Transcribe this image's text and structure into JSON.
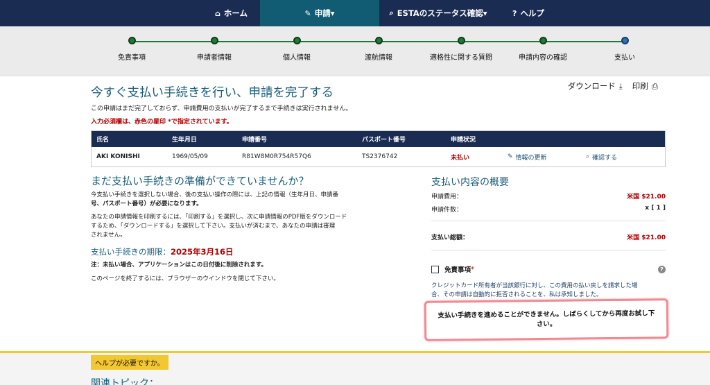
{
  "nav": {
    "home": "ホーム",
    "apply": "申請▾",
    "status": "ESTAのステータス確認▾",
    "help": "ヘルプ"
  },
  "steps": [
    "免責事項",
    "申請者情報",
    "個人情報",
    "渡航情報",
    "適格性に関する質問",
    "申請内容の確認",
    "支払い"
  ],
  "page": {
    "title": "今すぐ支払い手続きを行い、申請を完了する",
    "download": "ダウンロード",
    "print": "印刷",
    "notice": "この申請はまだ完了しておらず、申請費用の支払いが完了するまで手続きは実行されません。",
    "required_note": "入力必須欄は、赤色の星印 *で指定されています。"
  },
  "table": {
    "headers": [
      "氏名",
      "生年月日",
      "申請番号",
      "パスポート番号",
      "申請状況"
    ],
    "row": {
      "name": "AKI KONISHI",
      "dob": "1969/05/09",
      "app_no": "R81W8M0R754R57Q6",
      "passport": "TS2376742",
      "status": "未払い",
      "update": "情報の更新",
      "check": "確認する"
    }
  },
  "left": {
    "heading": "まだ支払い手続きの準備ができていませんか？",
    "p1_line1": "今支払い手続きを選択しない場合、後の支払い操作の際には、上記の情報（生年月日、申請番",
    "p1_line2": "号、パスポート番号）が必要になります。",
    "p2_line1": "あなたの申請情報を印刷するには、「印刷する」を選択し、次に申請情報のPDF版をダウンロード",
    "p2_line2": "するため、「ダウンロードする」を選択して下さい。支払いが済むまで、あなたの申請は審理",
    "p2_line3": "されません。",
    "deadline_label": "支払い手続きの期限：",
    "deadline_date": "2025年3月16日",
    "note": "注：未払い場合、アプリケーションはこの日付後に削除されます。",
    "close": "このページを終了するには、ブラウザーのウインドウを閉じて下さい。"
  },
  "summary": {
    "title": "支払い内容の概要",
    "fee_label": "申請費用：",
    "fee_value": "米国 $21.00",
    "count_label": "申請件数：",
    "count_value": "x [ 1 ]",
    "total_label": "支払い総額：",
    "total_value": "米国 $21.00",
    "consent_label": "免責事項",
    "consent_text_1": "クレジットカード所有者が当該銀行に対し、この費用の払い戻しを請求した場",
    "consent_text_2": "合、その申請は自動的に拒否されることを、私は承知しました。"
  },
  "error": {
    "message": "支払い手続きを進めることができません。しばらくしてから再度お試し下さい。"
  },
  "footer": {
    "help": "ヘルプが必要ですか。",
    "topics": "関連トピック："
  },
  "colors": {
    "nav_bg": "#1b2c52",
    "nav_active": "#125c73",
    "title": "#1b5e7a",
    "alert_red": "#b00000",
    "progress_green": "#1f7a35",
    "footer_yellow": "#f3c72f"
  }
}
